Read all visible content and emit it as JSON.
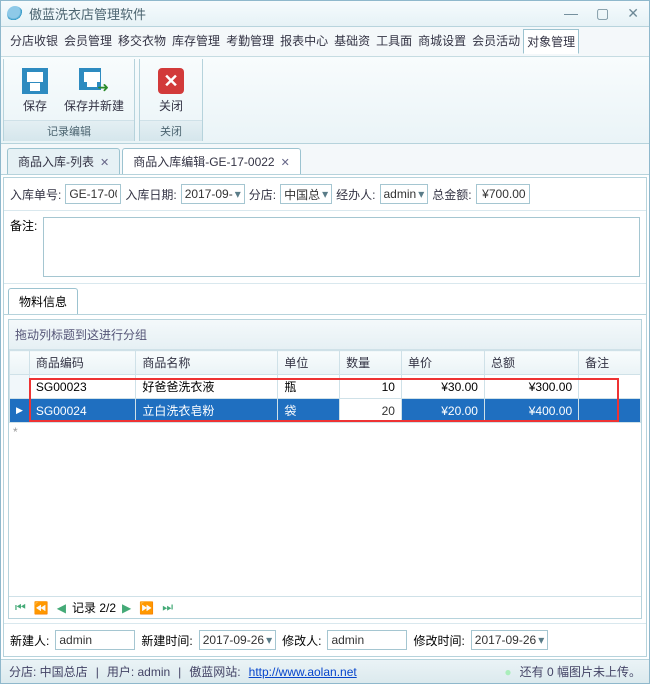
{
  "title": "傲蓝洗衣店管理软件",
  "window_buttons": {
    "min": "—",
    "max": "▢",
    "close": "✕"
  },
  "menu": [
    "分店收银",
    "会员管理",
    "移交衣物",
    "库存管理",
    "考勤管理",
    "报表中心",
    "基础资",
    "工具面",
    "商城设置",
    "会员活动",
    "对象管理"
  ],
  "menu_active_index": 10,
  "ribbon": {
    "group1_label": "记录编辑",
    "save": "保存",
    "save_new": "保存并新建",
    "group2_label": "关闭",
    "close": "关闭"
  },
  "tabs": [
    {
      "label": "商品入库-列表",
      "active": false
    },
    {
      "label": "商品入库编辑-GE-17-0022",
      "active": true
    }
  ],
  "fields": {
    "inbound_no_label": "入库单号:",
    "inbound_no": "GE-17-00",
    "inbound_date_label": "入库日期:",
    "inbound_date": "2017-09-",
    "branch_label": "分店:",
    "branch": "中国总",
    "handler_label": "经办人:",
    "handler": "admin",
    "total_label": "总金额:",
    "total": "¥700.00",
    "remark_label": "备注:",
    "remark": ""
  },
  "inner_tab": "物料信息",
  "group_hint": "拖动列标题到这进行分组",
  "columns": [
    "商品编码",
    "商品名称",
    "单位",
    "数量",
    "单价",
    "总额",
    "备注"
  ],
  "rows": [
    {
      "code": "SG00023",
      "name": "好爸爸洗衣液",
      "unit": "瓶",
      "qty": "10",
      "price": "¥30.00",
      "amount": "¥300.00",
      "remark": ""
    },
    {
      "code": "SG00024",
      "name": "立白洗衣皂粉",
      "unit": "袋",
      "qty": "20",
      "price": "¥20.00",
      "amount": "¥400.00",
      "remark": ""
    }
  ],
  "selected_row_index": 1,
  "pager": {
    "text": "记录 2/2",
    "first": "⏮",
    "prev_all": "⏪",
    "prev": "◀",
    "next": "▶",
    "next_all": "⏩",
    "last": "⏭"
  },
  "footer": {
    "creator_label": "新建人:",
    "creator": "admin",
    "ctime_label": "新建时间:",
    "ctime": "2017-09-26",
    "modifier_label": "修改人:",
    "modifier": "admin",
    "mtime_label": "修改时间:",
    "mtime": "2017-09-26"
  },
  "status": {
    "branch_prefix": "分店: ",
    "branch": "中国总店",
    "user_prefix": "用户: ",
    "user": "admin",
    "site_label": "傲蓝网站:",
    "site_url": "http://www.aolan.net",
    "upload": "还有 0 幅图片未上传。"
  }
}
